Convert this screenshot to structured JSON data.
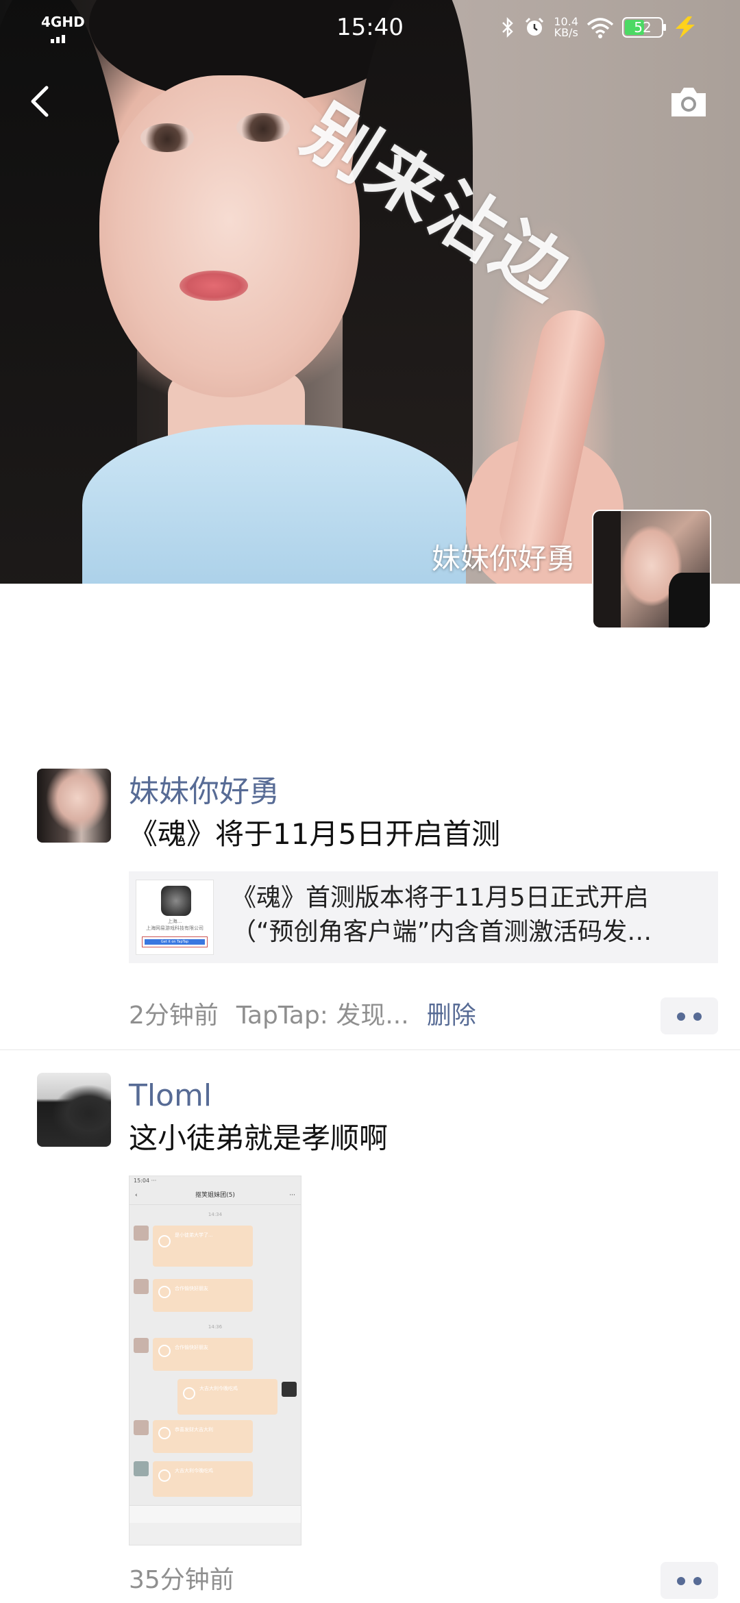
{
  "status_bar": {
    "network": "4GHD",
    "time": "15:40",
    "speed_value": "10.4",
    "speed_unit": "KB/s",
    "battery": "52",
    "icons": [
      "bluetooth-icon",
      "alarm-icon",
      "wifi-icon",
      "battery-icon",
      "charging-icon"
    ]
  },
  "header": {
    "back_icon": "chevron-left-icon",
    "camera_icon": "camera-icon"
  },
  "cover": {
    "watermark_text": "别来沾边",
    "owner_name": "妹妹你好勇"
  },
  "posts": [
    {
      "author": "妹妹你好勇",
      "text": "《魂》将于11月5日开启首测",
      "share_card": {
        "title": "《魂》首测版本将于11月5日正式开启（“预创角客户端”内含首测激活码发…",
        "thumb_line1": "上海...",
        "thumb_line2": "上海网易游戏科技有限公司",
        "thumb_button": "Get it on TapTap"
      },
      "time": "2分钟前",
      "source": "TapTap: 发现...",
      "delete_label": "删除"
    },
    {
      "author": "Tloml",
      "text": "这小徒弟就是孝顺啊",
      "image": {
        "status_time": "15:04",
        "chat_title": "抠笑姐妹团(5)",
        "timestamps": [
          "14:34",
          "14:36"
        ],
        "packets": [
          "是小徒弟大学了...",
          "合作愉快好朋友",
          "合作愉快好朋友",
          "大吉大利今晚吃鸡",
          "恭喜发财大吉大利",
          "大吉大利今晚吃鸡"
        ]
      },
      "time": "35分钟前"
    }
  ],
  "colors": {
    "link": "#576b95",
    "meta": "#8f8f8f",
    "card_bg": "#f3f3f5",
    "battery_fill": "#4cd964",
    "charge": "#ffd21c"
  }
}
